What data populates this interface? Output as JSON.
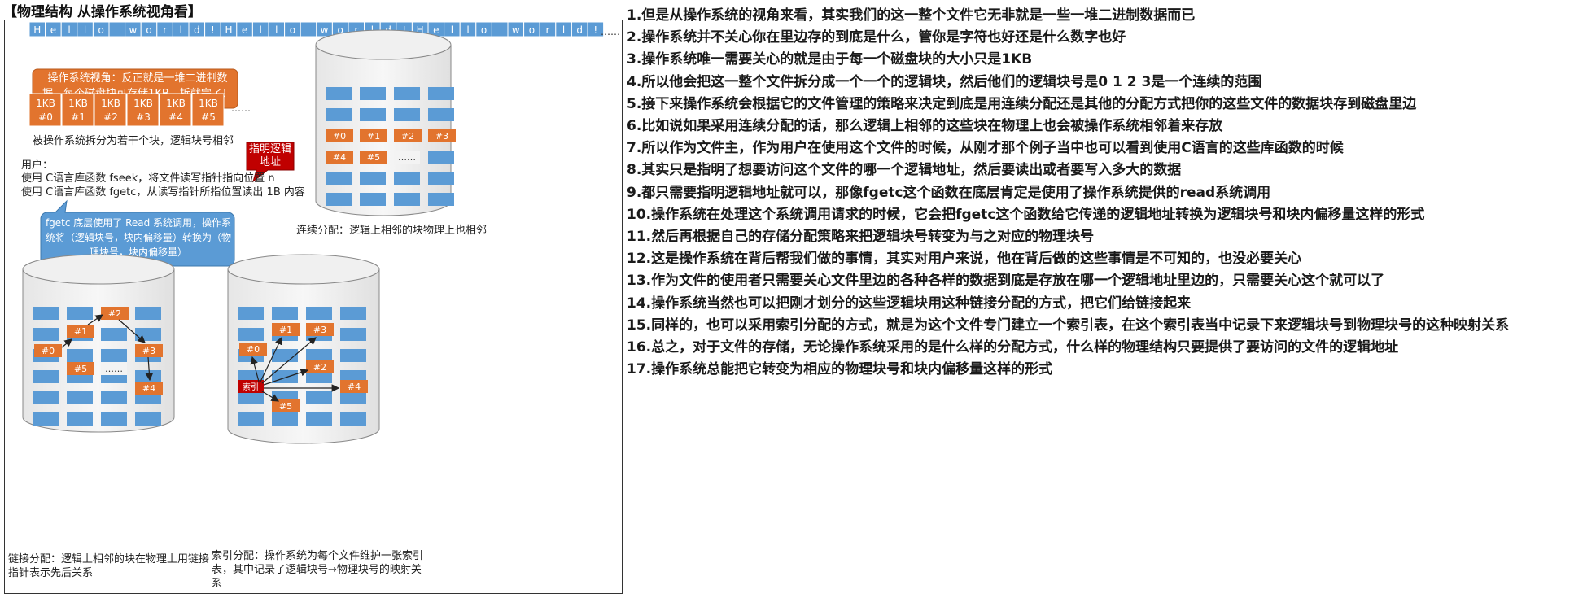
{
  "title": "【物理结构 从操作系统视角看】",
  "diagram": {
    "hello_chars": [
      "H",
      "e",
      "l",
      "l",
      "o",
      "",
      "w",
      "o",
      "r",
      "l",
      "d",
      "!",
      "H",
      "e",
      "l",
      "l",
      "o",
      "",
      "w",
      "o",
      "r",
      "l",
      "d",
      "!",
      "H",
      "e",
      "l",
      "l",
      "o",
      "",
      "w",
      "o",
      "r",
      "l",
      "d",
      "!"
    ],
    "hello_ellipsis": "……",
    "os_bubble": "操作系统视角：反正就是一堆二进制数据，每个磁盘块可存储1KB，拆就完了！",
    "logic_blocks": [
      {
        "size": "1KB",
        "id": "#0"
      },
      {
        "size": "1KB",
        "id": "#1"
      },
      {
        "size": "1KB",
        "id": "#2"
      },
      {
        "size": "1KB",
        "id": "#3"
      },
      {
        "size": "1KB",
        "id": "#4"
      },
      {
        "size": "1KB",
        "id": "#5"
      }
    ],
    "logic_ellipsis": "……",
    "split_caption": "被操作系统拆分为若干个块，逻辑块号相邻",
    "user_label": "用户：",
    "user_line1": "使用 C语言库函数 fseek，将文件读写指针指向位置 n",
    "user_line2": "使用 C语言库函数 fgetc，从读写指针所指位置读出 1B 内容",
    "red_callout": "指明逻辑地址",
    "blue_bubble": "fgetc 底层使用了 Read 系统调用，操作系统将（逻辑块号，块内偏移量）转换为（物理块号，块内偏移量）",
    "contiguous_caption": "连续分配：逻辑上相邻的块物理上也相邻",
    "contiguous_blocks": [
      "#0",
      "#1",
      "#2",
      "#3",
      "#4",
      "#5"
    ],
    "contiguous_ellipsis": "……",
    "linked_blocks": [
      "#0",
      "#1",
      "#2",
      "#3",
      "#4",
      "#5"
    ],
    "linked_ellipsis": "……",
    "linked_caption": "链接分配：逻辑上相邻的块在物理上用链接指针表示先后关系",
    "indexed_blocks": [
      "#0",
      "#1",
      "#2",
      "#3",
      "#4",
      "#5"
    ],
    "index_label": "索引",
    "indexed_caption": "索引分配：操作系统为每个文件维护一张索引表，其中记录了逻辑块号→物理块号的映射关系",
    "colors": {
      "orange": "#e2742e",
      "blue": "#5b9bd5",
      "red": "#c00000",
      "bubble_blue": "#5b9bd5"
    }
  },
  "notes": [
    "1.但是从操作系统的视角来看，其实我们的这一整个文件它无非就是一些一堆二进制数据而已",
    "2.操作系统并不关心你在里边存的到底是什么，管你是字符也好还是什么数字也好",
    "3.操作系统唯一需要关心的就是由于每一个磁盘块的大小只是1KB",
    "4.所以他会把这一整个文件拆分成一个一个的逻辑块，然后他们的逻辑块号是0 1 2 3是一个连续的范围",
    "5.接下来操作系统会根据它的文件管理的策略来决定到底是用连续分配还是其他的分配方式把你的这些文件的数据块存到磁盘里边",
    "6.比如说如果采用连续分配的话，那么逻辑上相邻的这些块在物理上也会被操作系统相邻着来存放",
    "7.所以作为文件主，作为用户在使用这个文件的时候，从刚才那个例子当中也可以看到使用C语言的这些库函数的时候",
    "8.其实只是指明了想要访问这个文件的哪一个逻辑地址，然后要读出或者要写入多大的数据",
    "9.都只需要指明逻辑地址就可以，那像fgetc这个函数在底层肯定是使用了操作系统提供的read系统调用",
    "10.操作系统在处理这个系统调用请求的时候，它会把fgetc这个函数给它传递的逻辑地址转换为逻辑块号和块内偏移量这样的形式",
    "11.然后再根据自己的存储分配策略来把逻辑块号转变为与之对应的物理块号",
    "12.这是操作系统在背后帮我们做的事情，其实对用户来说，他在背后做的这些事情是不可知的，也没必要关心",
    "13.作为文件的使用者只需要关心文件里边的各种各样的数据到底是存放在哪一个逻辑地址里边的，只需要关心这个就可以了",
    "14.操作系统当然也可以把刚才划分的这些逻辑块用这种链接分配的方式，把它们给链接起来",
    "15.同样的，也可以采用索引分配的方式，就是为这个文件专门建立一个索引表，在这个索引表当中记录下来逻辑块号到物理块号的这种映射关系",
    "16.总之，对于文件的存储，无论操作系统采用的是什么样的分配方式，什么样的物理结构只要提供了要访问的文件的逻辑地址",
    "17.操作系统总能把它转变为相应的物理块号和块内偏移量这样的形式"
  ]
}
